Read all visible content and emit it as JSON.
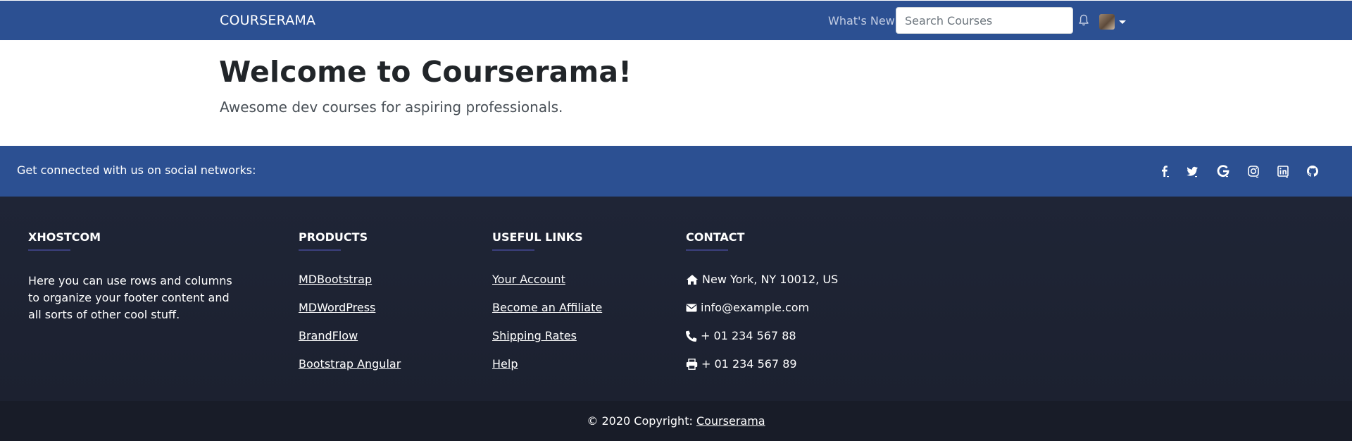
{
  "navbar": {
    "brand": "COURSERAMA",
    "whats_new": "What's New",
    "search_placeholder": "Search Courses",
    "color": "#2c5092"
  },
  "hero": {
    "title": "Welcome to Courserama!",
    "subtitle": "Awesome dev courses for aspiring professionals."
  },
  "social": {
    "text": "Get connected with us on social networks:",
    "icons": [
      "facebook-icon",
      "twitter-icon",
      "google-icon",
      "instagram-icon",
      "linkedin-icon",
      "github-icon"
    ]
  },
  "footer": {
    "about": {
      "title": "XHOSTCOM",
      "text": "Here you can use rows and columns to organize your footer content and all sorts of other cool stuff."
    },
    "products": {
      "title": "PRODUCTS",
      "items": [
        "MDBootstrap",
        "MDWordPress",
        "BrandFlow",
        "Bootstrap Angular"
      ]
    },
    "useful_links": {
      "title": "USEFUL LINKS",
      "items": [
        "Your Account",
        "Become an Affiliate",
        "Shipping Rates",
        "Help"
      ]
    },
    "contact": {
      "title": "CONTACT",
      "address": "New York, NY 10012, US",
      "email": "info@example.com",
      "phone": "+ 01 234 567 88",
      "fax": "+ 01 234 567 89"
    }
  },
  "copyright": {
    "prefix": "© 2020 Copyright:",
    "link": "Courserama"
  }
}
